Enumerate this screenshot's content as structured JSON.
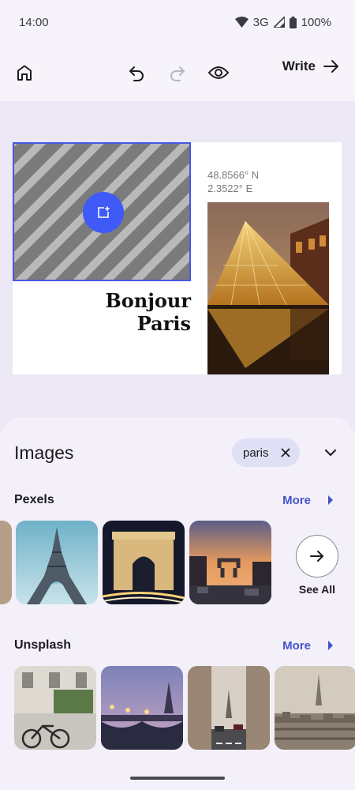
{
  "status_bar": {
    "time": "14:00",
    "network": "3G",
    "battery": "100%"
  },
  "toolbar": {
    "write_label": "Write"
  },
  "design": {
    "latitude": "48.8566° N",
    "longitude": "2.3522° E",
    "title_line1": "Bonjour",
    "title_line2": "Paris"
  },
  "sheet": {
    "title": "Images",
    "query_chip": "paris",
    "sections": [
      {
        "label": "Pexels",
        "more": "More",
        "see_all": "See All"
      },
      {
        "label": "Unsplash",
        "more": "More"
      }
    ]
  },
  "colors": {
    "accent": "#3f5af7",
    "link": "#4453c8",
    "chip": "#dfe0f5",
    "selection": "#4858e0"
  },
  "icons": [
    "home-icon",
    "undo-icon",
    "redo-icon",
    "preview-eye-icon",
    "arrow-right-icon",
    "add-photo-icon",
    "close-icon",
    "chevron-down-icon",
    "triangle-right-icon"
  ]
}
